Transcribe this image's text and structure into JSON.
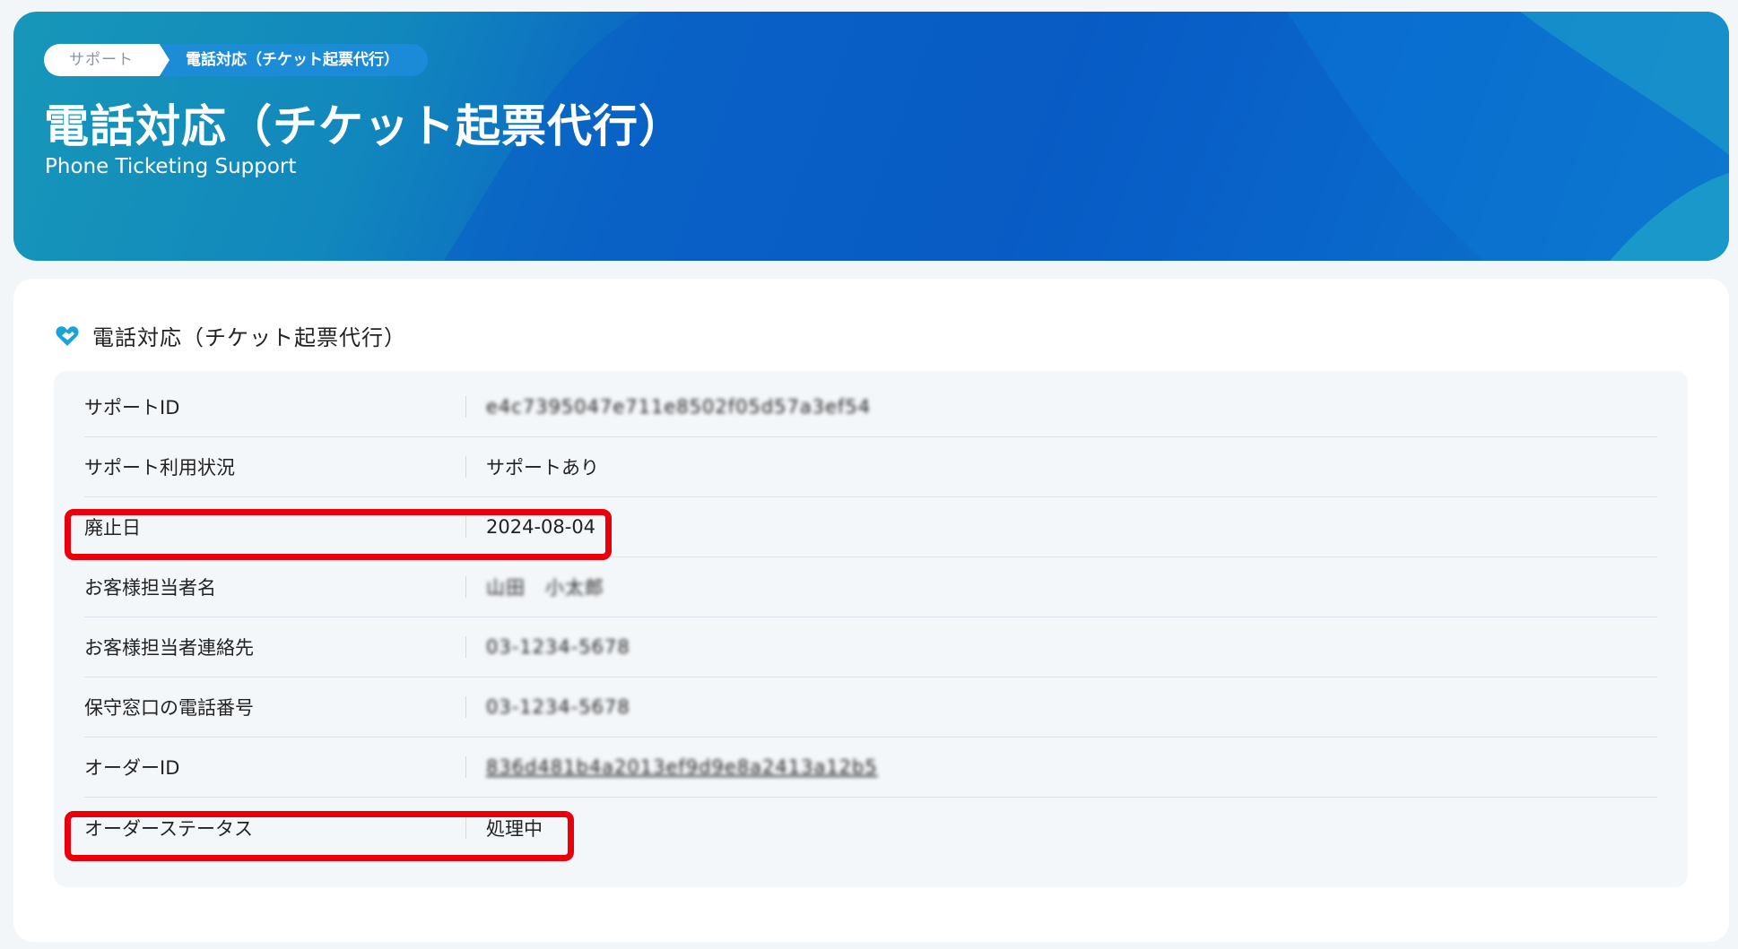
{
  "breadcrumb": {
    "parent": "サポート",
    "current": "電話対応（チケット起票代行）"
  },
  "hero": {
    "title": "電話対応（チケット起票代行）",
    "subtitle": "Phone Ticketing Support"
  },
  "section": {
    "title": "電話対応（チケット起票代行）",
    "icon": "heart-handshake-icon"
  },
  "rows": [
    {
      "label": "サポートID",
      "value": "e4c7395047e711e8502f05d57a3ef54"
    },
    {
      "label": "サポート利用状況",
      "value": "サポートあり"
    },
    {
      "label": "廃止日",
      "value": "2024-08-04"
    },
    {
      "label": "お客様担当者名",
      "value": "山田　小太郎"
    },
    {
      "label": "お客様担当者連絡先",
      "value": "03-1234-5678"
    },
    {
      "label": "保守窓口の電話番号",
      "value": "03-1234-5678"
    },
    {
      "label": "オーダーID",
      "value": "836d481b4a2013ef9d9e8a2413a12b5"
    },
    {
      "label": "オーダーステータス",
      "value": "処理中"
    }
  ],
  "colors": {
    "accent": "#0758c2",
    "highlight": "#e8000b",
    "link": "#2c7be5"
  }
}
